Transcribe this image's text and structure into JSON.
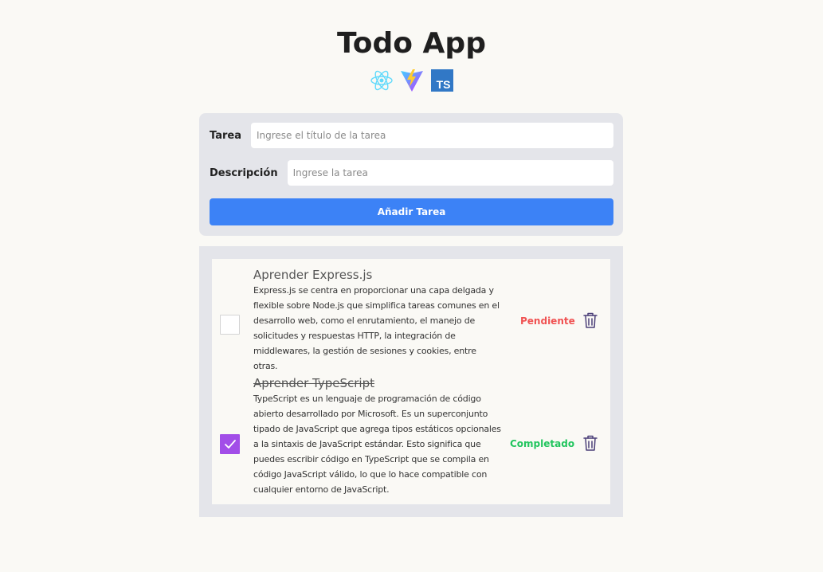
{
  "app": {
    "title": "Todo App",
    "logos": [
      "react-icon",
      "vite-icon",
      "typescript-icon"
    ],
    "ts_logo_text": "TS"
  },
  "form": {
    "title_label": "Tarea",
    "title_placeholder": "Ingrese el título de la tarea",
    "title_value": "",
    "desc_label": "Descripción",
    "desc_placeholder": "Ingrese la tarea",
    "desc_value": "",
    "submit_label": "Añadir Tarea"
  },
  "tasks": [
    {
      "title": "Aprender Express.js",
      "description": "Express.js se centra en proporcionar una capa delgada y flexible sobre Node.js que simplifica tareas comunes en el desarrollo web, como el enrutamiento, el manejo de solicitudes y respuestas HTTP, la integración de middlewares, la gestión de sesiones y cookies, entre otras.",
      "completed": false,
      "status": "Pendiente"
    },
    {
      "title": "Aprender TypeScript",
      "description": "TypeScript es un lenguaje de programación de código abierto desarrollado por Microsoft. Es un superconjunto tipado de JavaScript que agrega tipos estáticos opcionales a la sintaxis de JavaScript estándar. Esto significa que puedes escribir código en TypeScript que se compila en código JavaScript válido, lo que lo hace compatible con cualquier entorno de JavaScript.",
      "completed": true,
      "status": "Completado"
    }
  ],
  "colors": {
    "background": "#faf9f5",
    "card": "#e4e5ea",
    "primary": "#3c82f6",
    "checkbox_checked": "#a24ee8",
    "status_pending": "#f05252",
    "status_completed": "#22c55e",
    "trash": "#4b3f78"
  }
}
